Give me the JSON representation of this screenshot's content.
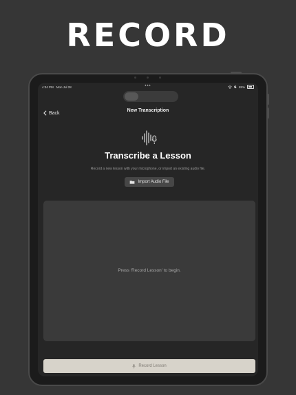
{
  "headline": "RECORD",
  "status_bar": {
    "time": "4:34 PM",
    "date": "Mon Jul 28",
    "battery": "85%"
  },
  "nav": {
    "back_label": "Back",
    "title": "New Transcription"
  },
  "main": {
    "heading": "Transcribe a Lesson",
    "description": "Record a new lesson with your microphone, or import an existing audio file.",
    "import_button": "Import Audio File",
    "placeholder": "Press 'Record Lesson' to begin.",
    "record_button": "Record Lesson"
  },
  "icons": {
    "back": "chevron-left-icon",
    "waveform": "waveform-mic-icon",
    "folder": "folder-icon",
    "mic": "mic-icon",
    "wifi": "wifi-icon",
    "moon": "moon-icon",
    "battery": "battery-icon"
  },
  "colors": {
    "background": "#363636",
    "screen": "#262626",
    "panel": "#3a3a3a",
    "record_button": "#d7d3ca"
  }
}
